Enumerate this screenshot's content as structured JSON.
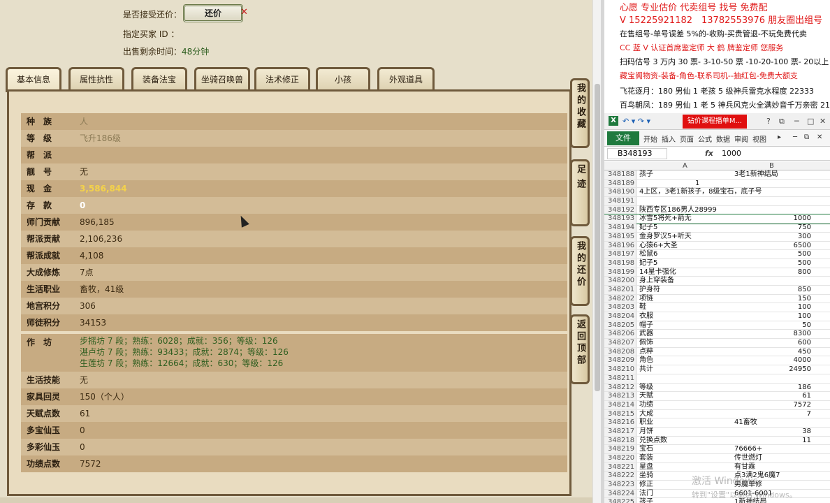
{
  "header": {
    "accept_label": "是否接受还价：",
    "back_button": "还价",
    "buyer_label": "指定买家 ID ：",
    "time_label": "出售剩余时间：",
    "time_value": "48分钟"
  },
  "tabs": [
    "基本信息",
    "属性抗性",
    "装备法宝",
    "坐骑召唤兽",
    "法术修正",
    "小孩",
    "外观道具"
  ],
  "rows": [
    {
      "k": "种　族",
      "v": "人",
      "style": "gray"
    },
    {
      "k": "等　级",
      "v": "飞升186级",
      "style": "gray"
    },
    {
      "k": "帮　派",
      "v": "",
      "style": ""
    },
    {
      "k": "靓　号",
      "v": "无",
      "style": ""
    },
    {
      "k": "现　金",
      "v": "3,586,844",
      "style": "gold"
    },
    {
      "k": "存　款",
      "v": "0",
      "style": "white"
    },
    {
      "k": "师门贡献",
      "v": "896,185",
      "style": ""
    },
    {
      "k": "帮派贡献",
      "v": "2,106,236",
      "style": ""
    },
    {
      "k": "帮派成就",
      "v": "4,108",
      "style": ""
    },
    {
      "k": "大成修炼",
      "v": "7点",
      "style": ""
    },
    {
      "k": "生活职业",
      "v": "畜牧，41级",
      "style": ""
    },
    {
      "k": "地宫积分",
      "v": "306",
      "style": ""
    },
    {
      "k": "师徒积分",
      "v": "34153",
      "style": ""
    }
  ],
  "zuofang": {
    "k": "作　坊",
    "lines": [
      "步摇坊 7 段；熟练：6028；成就：356；等级：126",
      "湛卢坊 7 段；熟练：93433；成就：2874；等级：126",
      "生莲坊 7 段；熟练：12664；成就：630；等级：126"
    ]
  },
  "rows2": [
    {
      "k": "生活技能",
      "v": "无"
    },
    {
      "k": "家具回灵",
      "v": "150（个人）"
    },
    {
      "k": "天赋点数",
      "v": "61"
    },
    {
      "k": "多宝仙玉",
      "v": "0"
    },
    {
      "k": "多彩仙玉",
      "v": "0"
    },
    {
      "k": "功绩点数",
      "v": "7572"
    }
  ],
  "side_buttons": [
    "我的收藏",
    "足迹",
    "我的还价",
    "返回顶部"
  ],
  "ads": [
    {
      "t": "心愿 专业估价 代卖组号 找号 免费配",
      "c": "red"
    },
    {
      "t": "V 15225921182　13782553976 朋友圈出组号",
      "c": "red"
    },
    {
      "t": "在售组号-单号误差 5%的-收购-买贵管退-不玩免费代卖",
      "c": "blk"
    },
    {
      "t": "CC 蓝 V 认证首席鉴定师 大 鹤 牌鉴定师 您服务",
      "c": "red"
    },
    {
      "t": "扫码估号 3 万内 30 票- 3-10-50 票 -10-20-100 票- 20以上 150",
      "c": "blk"
    },
    {
      "t": "藏宝阁物资-装备-角色-联系司机--抽红包-免费大额支",
      "c": "red"
    },
    {
      "t": "飞花逐月：180 男仙 1 老孩 5 级神兵雷克水程度 22333",
      "c": "blk"
    },
    {
      "t": "百鸟朝凤：189 男仙 1 老 5 神兵风克火全满妙音千万亲密 21",
      "c": "blk"
    }
  ],
  "excel": {
    "save_menu": "↶ ▾ ↷ ▾",
    "redbox": "钻价课程播单M...",
    "file": "文件",
    "ribbon": [
      "开始",
      "插入",
      "页面",
      "公式",
      "数据",
      "审阅",
      "视图"
    ],
    "namebox": "B348193",
    "fx": "fx",
    "formula": "1000",
    "col_a": "A",
    "col_b": "B",
    "rows": [
      {
        "n": "348188",
        "a": "孩子",
        "b": "3老1新神结局",
        "r": false
      },
      {
        "n": "348189",
        "a": "　　　　　　　　1",
        "b": "",
        "r": false
      },
      {
        "n": "348190",
        "a": "4上区，3老1新孩子，8级宝石，底子号",
        "b": "",
        "r": false
      },
      {
        "n": "348191",
        "a": "",
        "b": "",
        "r": false
      },
      {
        "n": "348192",
        "a": "陕西专区186男人28999",
        "b": "",
        "r": false
      },
      {
        "n": "348193",
        "a": "冰雪5将死+箭无",
        "b": "1000",
        "r": true
      },
      {
        "n": "348194",
        "a": "妃子5",
        "b": "750",
        "r": true
      },
      {
        "n": "348195",
        "a": "金身罗汉5+听天",
        "b": "300",
        "r": true
      },
      {
        "n": "348196",
        "a": "心猿6+大圣",
        "b": "6500",
        "r": true
      },
      {
        "n": "348197",
        "a": "松鼠6",
        "b": "500",
        "r": true
      },
      {
        "n": "348198",
        "a": "妃子5",
        "b": "500",
        "r": true
      },
      {
        "n": "348199",
        "a": "14星卡强化",
        "b": "800",
        "r": true
      },
      {
        "n": "348200",
        "a": "身上穿装备",
        "b": "",
        "r": false
      },
      {
        "n": "348201",
        "a": "护身符",
        "b": "850",
        "r": true
      },
      {
        "n": "348202",
        "a": "项链",
        "b": "150",
        "r": true
      },
      {
        "n": "348203",
        "a": "鞋",
        "b": "100",
        "r": true
      },
      {
        "n": "348204",
        "a": "衣服",
        "b": "100",
        "r": true
      },
      {
        "n": "348205",
        "a": "帽子",
        "b": "50",
        "r": true
      },
      {
        "n": "348206",
        "a": "武器",
        "b": "8300",
        "r": true
      },
      {
        "n": "348207",
        "a": "佩饰",
        "b": "600",
        "r": true
      },
      {
        "n": "348208",
        "a": "点粹",
        "b": "450",
        "r": true
      },
      {
        "n": "348209",
        "a": "角色",
        "b": "4000",
        "r": true
      },
      {
        "n": "348210",
        "a": "共计",
        "b": "24950",
        "r": true
      },
      {
        "n": "348211",
        "a": "",
        "b": "",
        "r": false
      },
      {
        "n": "348212",
        "a": "等级",
        "b": "186",
        "r": true
      },
      {
        "n": "348213",
        "a": "天赋",
        "b": "61",
        "r": true
      },
      {
        "n": "348214",
        "a": "功绩",
        "b": "7572",
        "r": true
      },
      {
        "n": "348215",
        "a": "大成",
        "b": "7",
        "r": true
      },
      {
        "n": "348216",
        "a": "职业",
        "b": "41畜牧",
        "r": false
      },
      {
        "n": "348217",
        "a": "月饼",
        "b": "38",
        "r": true
      },
      {
        "n": "348218",
        "a": "兑换点数",
        "b": "11",
        "r": true
      },
      {
        "n": "348219",
        "a": "宝石",
        "b": "76666+",
        "r": false
      },
      {
        "n": "348220",
        "a": "套装",
        "b": "传世燃灯",
        "r": false
      },
      {
        "n": "348221",
        "a": "星盘",
        "b": "有甘霖",
        "r": false
      },
      {
        "n": "348222",
        "a": "坐骑",
        "b": "点3满2鬼6魔7",
        "r": false
      },
      {
        "n": "348223",
        "a": "修正",
        "b": "男魔单修",
        "r": false
      },
      {
        "n": "348224",
        "a": "法门",
        "b": "6601-6001",
        "r": false
      },
      {
        "n": "348225",
        "a": "孩子",
        "b": "1新神结局",
        "r": false
      }
    ]
  },
  "watermark": "激活 Windows",
  "watermark_sub": "转到\"设置\"以激活 Windows。"
}
